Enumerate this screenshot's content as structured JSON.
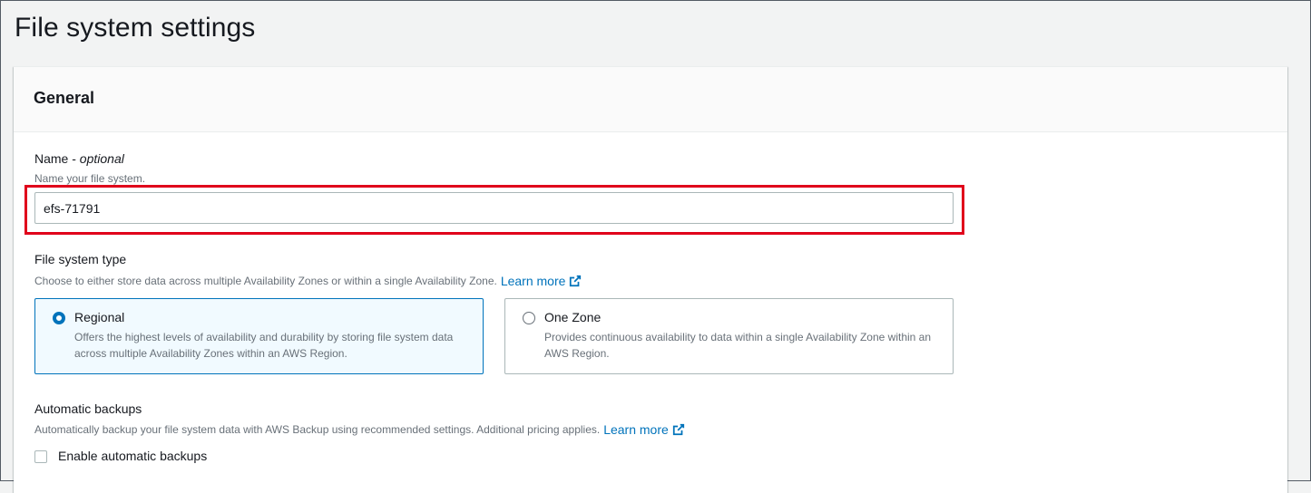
{
  "page": {
    "title": "File system settings"
  },
  "general": {
    "title": "General",
    "name_field": {
      "label": "Name - ",
      "label_optional": "optional",
      "description": "Name your file system.",
      "value": "efs-71791"
    },
    "file_system_type": {
      "label": "File system type",
      "description": "Choose to either store data across multiple Availability Zones or within a single Availability Zone.",
      "learn_more": "Learn more",
      "options": [
        {
          "title": "Regional",
          "description": "Offers the highest levels of availability and durability by storing file system data across multiple Availability Zones within an AWS Region.",
          "selected": true
        },
        {
          "title": "One Zone",
          "description": "Provides continuous availability to data within a single Availability Zone within an AWS Region.",
          "selected": false
        }
      ]
    },
    "automatic_backups": {
      "label": "Automatic backups",
      "description": "Automatically backup your file system data with AWS Backup using recommended settings. Additional pricing applies.",
      "learn_more": "Learn more",
      "checkbox_label": "Enable automatic backups",
      "checked": false
    }
  },
  "colors": {
    "accent": "#0073bb",
    "highlight": "#e0001b"
  },
  "icons": {
    "external_link": "external-link-icon"
  }
}
